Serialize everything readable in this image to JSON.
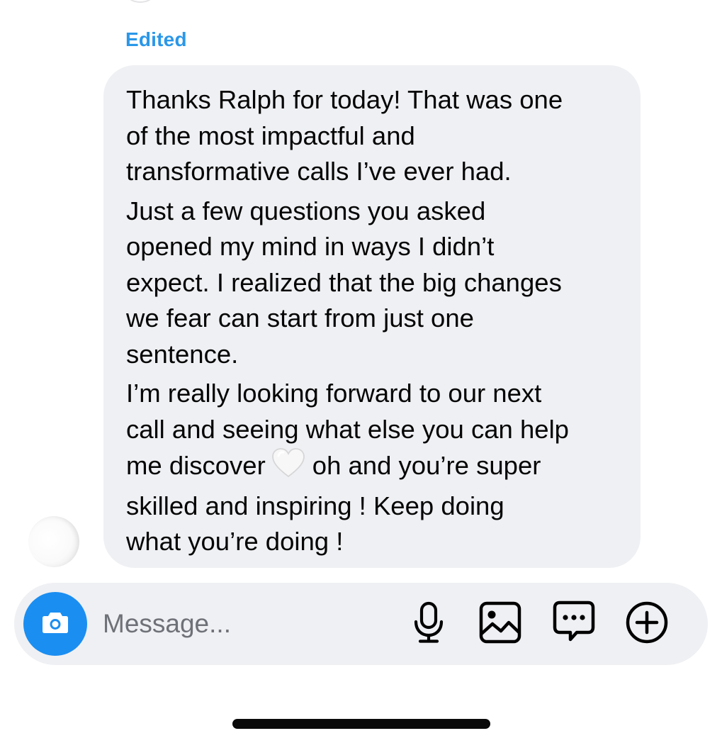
{
  "message": {
    "edited_label": "Edited",
    "paragraphs": [
      {
        "lines": [
          "Thanks Ralph for today! That was one",
          "of the most impactful and",
          "transformative calls I’ve ever had."
        ]
      },
      {
        "lines": [
          "Just a few questions you asked",
          "opened my mind in ways I didn’t",
          "expect. I realized that the big changes",
          "we fear can start from just one",
          "sentence."
        ]
      },
      {
        "lines": [
          "I’m really looking forward to our next",
          "call and seeing what else you can help"
        ],
        "emoji_line": {
          "before": "me discover",
          "emoji": "white-heart-icon",
          "after": "oh and you’re super"
        },
        "lines_after": [
          "skilled and inspiring ! Keep doing",
          "what you’re doing !"
        ]
      }
    ],
    "bubble_color": "#eff0f3"
  },
  "composer": {
    "placeholder": "Message...",
    "value": "",
    "camera_icon": "camera-icon",
    "actions": [
      "microphone-icon",
      "gallery-icon",
      "sticker-chat-icon",
      "add-icon"
    ],
    "camera_button_color": "#1b8ef1"
  },
  "colors": {
    "edited_label": "#2a97e8",
    "placeholder": "#6f7178"
  }
}
